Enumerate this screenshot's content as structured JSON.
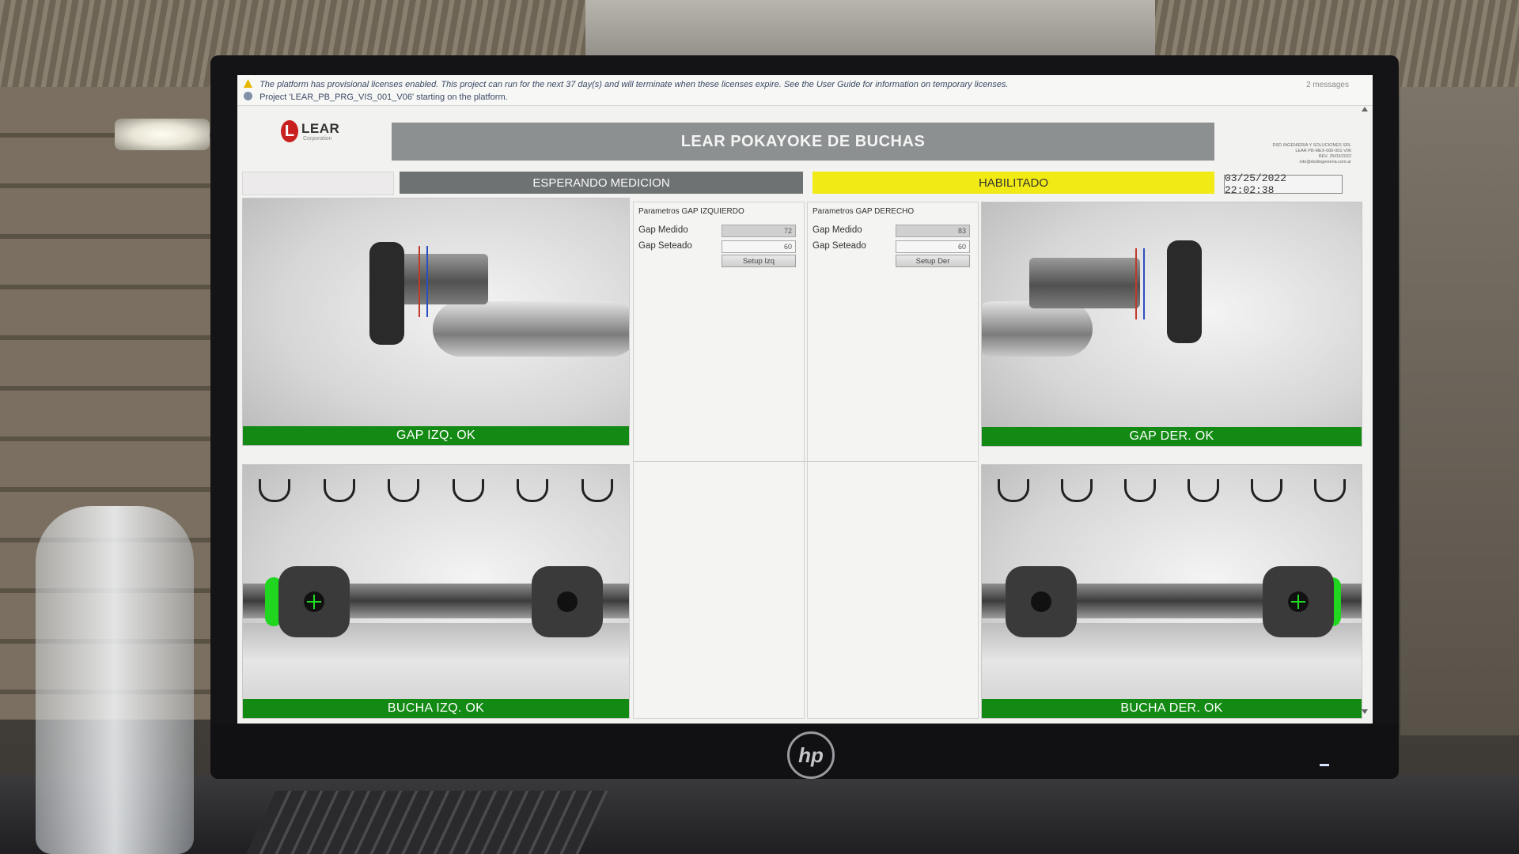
{
  "warning_bar": {
    "line1": "The platform has provisional licenses enabled. This project can run for the next 37 day(s) and will terminate when these licenses expire. See the User Guide for information on temporary licenses.",
    "line2": "Project 'LEAR_PB_PRG_VIS_001_V06' starting on the platform.",
    "messages_label": "2 messages"
  },
  "header": {
    "logo_text": "LEAR",
    "logo_mark": "L",
    "logo_sub": "Corporation",
    "title": "LEAR POKAYOKE DE BUCHAS",
    "company_info": [
      "DSD INGENIERIA Y SOLUCIONES SRL",
      "LEAR PB-MEX-000-001-V06",
      "REV. 25/03/2022",
      "info@dsdingenieria.com.ar"
    ]
  },
  "status": {
    "measurement": "ESPERANDO MEDICION",
    "enabled": "HABILITADO",
    "datetime": "03/25/2022 22:02:38"
  },
  "colors": {
    "ok_green": "#138a14",
    "enabled_yellow": "#f2ea14",
    "banner_gray": "#8c9090",
    "status_gray": "#6e7272"
  },
  "params_left": {
    "title": "Parametros GAP IZQUIERDO",
    "gap_measured_label": "Gap Medido",
    "gap_measured_value": "72",
    "gap_set_label": "Gap Seteado",
    "gap_set_value": "60",
    "setup_button": "Setup Izq"
  },
  "params_right": {
    "title": "Parametros GAP DERECHO",
    "gap_measured_label": "Gap Medido",
    "gap_measured_value": "83",
    "gap_set_label": "Gap Seteado",
    "gap_set_value": "60",
    "setup_button": "Setup Der"
  },
  "results": {
    "gap_left": "GAP IZQ. OK",
    "gap_right": "GAP DER. OK",
    "bush_left": "BUCHA IZQ. OK",
    "bush_right": "BUCHA DER. OK"
  },
  "monitor": {
    "brand": "hp"
  }
}
